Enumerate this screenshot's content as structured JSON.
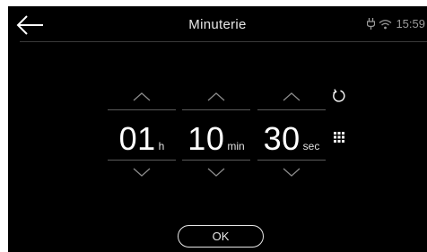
{
  "header": {
    "title": "Minuterie",
    "status_time": "15:59",
    "back_icon": "arrow-left-icon",
    "status_icons": [
      "plug-icon",
      "wifi-icon"
    ]
  },
  "timer": {
    "hours": {
      "value": "01",
      "unit": "h"
    },
    "minutes": {
      "value": "10",
      "unit": "min"
    },
    "seconds": {
      "value": "30",
      "unit": "sec"
    }
  },
  "actions": {
    "reset_icon": "reset-icon",
    "keypad_icon": "keypad-grid-icon",
    "ok_label": "OK"
  },
  "colors": {
    "background": "#000000",
    "text": "#ffffff",
    "divider": "#5a5a5a"
  }
}
